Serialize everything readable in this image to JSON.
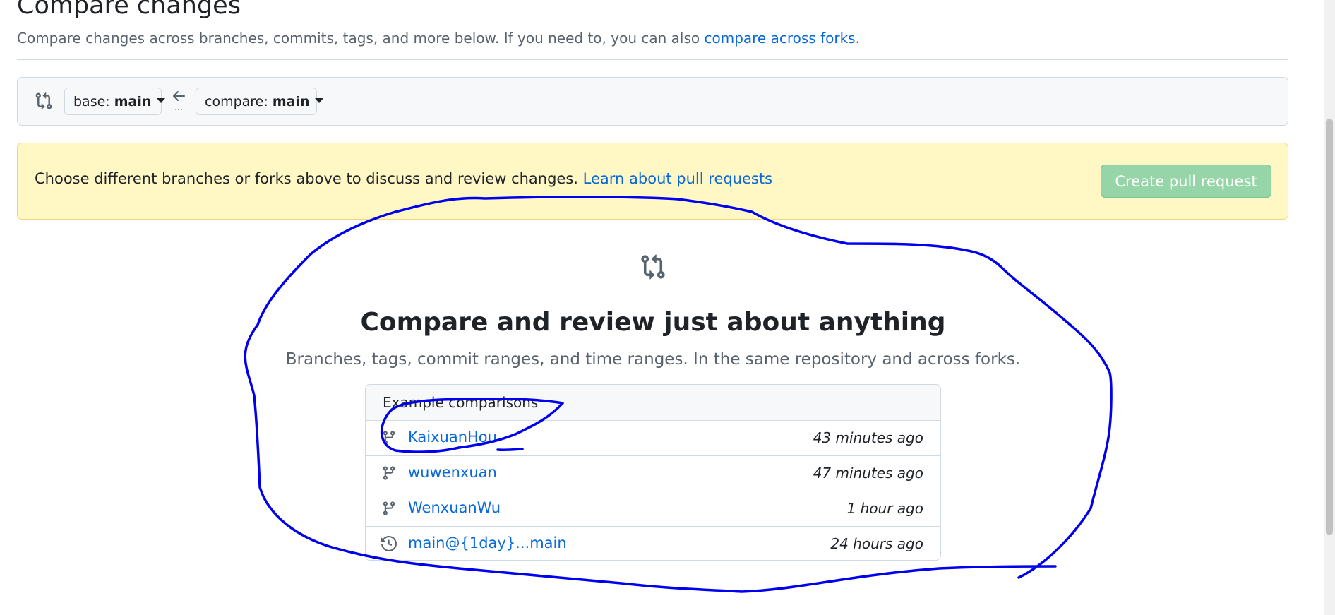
{
  "header": {
    "title": "Compare changes",
    "subtitle_prefix": "Compare changes across branches, commits, tags, and more below. If you need to, you can also ",
    "subtitle_link": "compare across forks",
    "subtitle_suffix": "."
  },
  "range": {
    "base_prefix": "base: ",
    "base_value": "main",
    "compare_prefix": "compare: ",
    "compare_value": "main",
    "separator": "..."
  },
  "flash": {
    "message": "Choose different branches or forks above to discuss and review changes. ",
    "link": "Learn about pull requests",
    "button": "Create pull request"
  },
  "blankslate": {
    "title": "Compare and review just about anything",
    "description": "Branches, tags, commit ranges, and time ranges. In the same repository and across forks."
  },
  "examples": {
    "header": "Example comparisons",
    "items": [
      {
        "name": "KaixuanHou",
        "time": "43 minutes ago",
        "icon": "git-branch-icon"
      },
      {
        "name": "wuwenxuan",
        "time": "47 minutes ago",
        "icon": "git-branch-icon"
      },
      {
        "name": "WenxuanWu",
        "time": "1 hour ago",
        "icon": "git-branch-icon"
      },
      {
        "name": "main@{1day}...main",
        "time": "24 hours ago",
        "icon": "history-icon"
      }
    ]
  },
  "colors": {
    "link": "#0969da",
    "flash_bg": "#fff8c5",
    "button_disabled_green": "#95d5a7",
    "annotation_stroke": "#0000ee"
  }
}
